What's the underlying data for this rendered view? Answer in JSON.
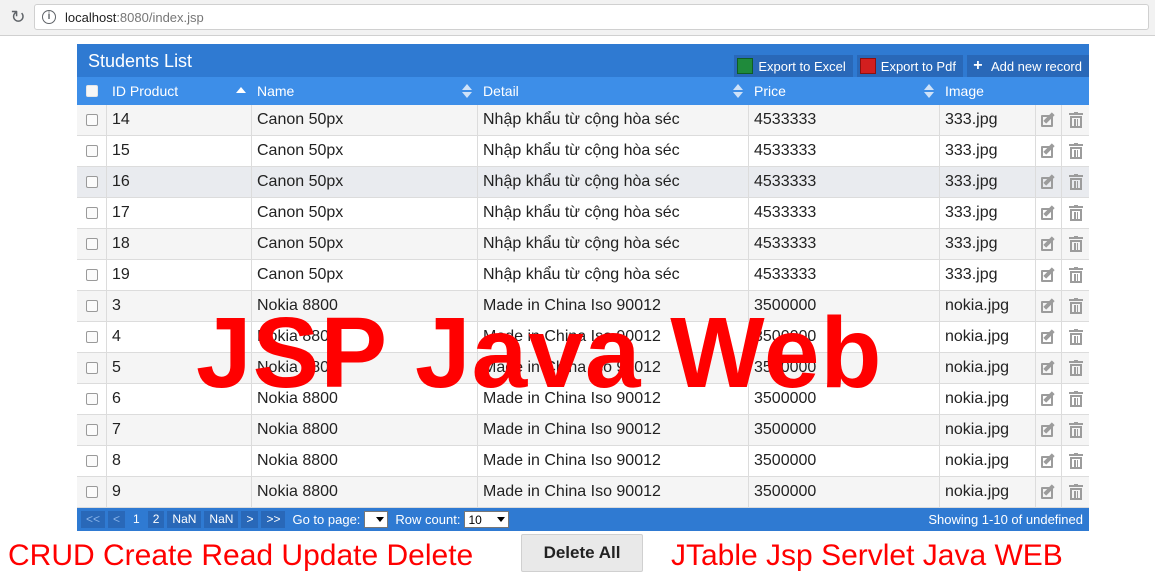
{
  "browser": {
    "url_host": "localhost",
    "url_rest": ":8080/index.jsp"
  },
  "table": {
    "title": "Students List",
    "toolbar": {
      "export_excel": "Export to Excel",
      "export_pdf": "Export to Pdf",
      "add_record": "Add new record"
    },
    "columns": {
      "id": "ID Product",
      "name": "Name",
      "detail": "Detail",
      "price": "Price",
      "image": "Image"
    },
    "rows": [
      {
        "id": "14",
        "name": "Canon 50px",
        "detail": "Nhập khẩu từ cộng hòa séc",
        "price": "4533333",
        "image": "333.jpg"
      },
      {
        "id": "15",
        "name": "Canon 50px",
        "detail": "Nhập khẩu từ cộng hòa séc",
        "price": "4533333",
        "image": "333.jpg"
      },
      {
        "id": "16",
        "name": "Canon 50px",
        "detail": "Nhập khẩu từ cộng hòa séc",
        "price": "4533333",
        "image": "333.jpg"
      },
      {
        "id": "17",
        "name": "Canon 50px",
        "detail": "Nhập khẩu từ cộng hòa séc",
        "price": "4533333",
        "image": "333.jpg"
      },
      {
        "id": "18",
        "name": "Canon 50px",
        "detail": "Nhập khẩu từ cộng hòa séc",
        "price": "4533333",
        "image": "333.jpg"
      },
      {
        "id": "19",
        "name": "Canon 50px",
        "detail": "Nhập khẩu từ cộng hòa séc",
        "price": "4533333",
        "image": "333.jpg"
      },
      {
        "id": "3",
        "name": "Nokia 8800",
        "detail": "Made in China Iso 90012",
        "price": "3500000",
        "image": "nokia.jpg"
      },
      {
        "id": "4",
        "name": "Nokia 8800",
        "detail": "Made in China Iso 90012",
        "price": "3500000",
        "image": "nokia.jpg"
      },
      {
        "id": "5",
        "name": "Nokia 8800",
        "detail": "Made in China Iso 90012",
        "price": "3500000",
        "image": "nokia.jpg"
      },
      {
        "id": "6",
        "name": "Nokia 8800",
        "detail": "Made in China Iso 90012",
        "price": "3500000",
        "image": "nokia.jpg"
      },
      {
        "id": "7",
        "name": "Nokia 8800",
        "detail": "Made in China Iso 90012",
        "price": "3500000",
        "image": "nokia.jpg"
      },
      {
        "id": "8",
        "name": "Nokia 8800",
        "detail": "Made in China Iso 90012",
        "price": "3500000",
        "image": "nokia.jpg"
      },
      {
        "id": "9",
        "name": "Nokia 8800",
        "detail": "Made in China Iso 90012",
        "price": "3500000",
        "image": "nokia.jpg"
      }
    ],
    "pager": {
      "first": "<<",
      "prev": "<",
      "pages": [
        "1",
        "2",
        "NaN",
        "NaN"
      ],
      "next": ">",
      "last": ">>",
      "goto_label": "Go to page:",
      "goto_value": "",
      "rowcount_label": "Row count:",
      "rowcount_value": "10",
      "info": "Showing 1-10 of undefined"
    }
  },
  "overlay_text": "JSP Java Web",
  "caption_left": "CRUD Create Read Update Delete",
  "delete_all": "Delete All",
  "caption_right": "JTable Jsp Servlet Java WEB",
  "colors": {
    "title_bg": "#2f7ad2",
    "header_bg": "#3d8ee8",
    "accent_red": "#ff0000"
  },
  "icons": {
    "reload": "reload-icon",
    "info": "info-icon",
    "excel": "excel-icon",
    "pdf": "pdf-icon",
    "add": "plus-icon",
    "edit": "edit-icon",
    "delete": "trash-icon"
  }
}
